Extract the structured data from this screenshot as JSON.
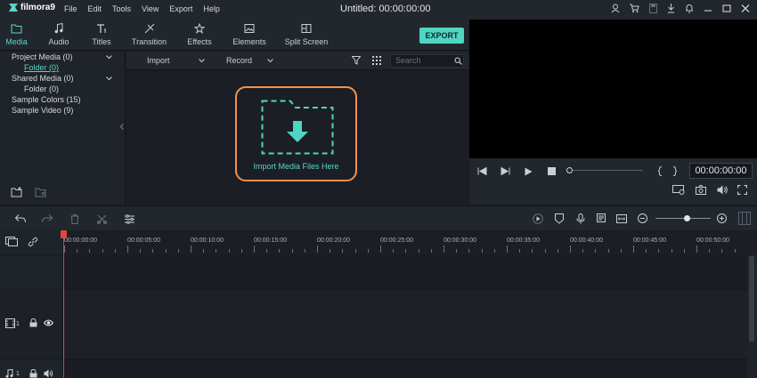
{
  "app": {
    "logo_text": "filmora9",
    "doc_title": "Untitled:  00:00:00:00"
  },
  "menu": [
    "File",
    "Edit",
    "Tools",
    "View",
    "Export",
    "Help"
  ],
  "tabs": [
    {
      "label": "Media",
      "icon": "folder-icon",
      "active": true
    },
    {
      "label": "Audio",
      "icon": "music-note-icon"
    },
    {
      "label": "Titles",
      "icon": "text-icon"
    },
    {
      "label": "Transition",
      "icon": "transition-icon"
    },
    {
      "label": "Effects",
      "icon": "effects-icon"
    },
    {
      "label": "Elements",
      "icon": "image-icon"
    },
    {
      "label": "Split Screen",
      "icon": "split-screen-icon"
    }
  ],
  "export_label": "EXPORT",
  "tree": {
    "project_media": "Project Media (0)",
    "project_folder": "Folder (0)",
    "shared_media": "Shared Media (0)",
    "shared_folder": "Folder (0)",
    "sample_colors": "Sample Colors (15)",
    "sample_video": "Sample Video (9)"
  },
  "media_toolbar": {
    "import": "Import",
    "record": "Record",
    "search_placeholder": "Search"
  },
  "dropzone_label": "Import Media Files Here",
  "preview": {
    "timecode": "00:00:00:00"
  },
  "ruler_ticks": [
    "00:00:00:00",
    "00:00:05:00",
    "00:00:10:00",
    "00:00:15:00",
    "00:00:20:00",
    "00:00:25:00",
    "00:00:30:00",
    "00:00:35:00",
    "00:00:40:00",
    "00:00:45:00",
    "00:00:50:00"
  ],
  "tracks": {
    "video_index": "1",
    "audio_index": "1"
  },
  "colors": {
    "accent": "#4fd6c2",
    "dropzone_border": "#f0934f",
    "playhead": "#e0463c"
  }
}
